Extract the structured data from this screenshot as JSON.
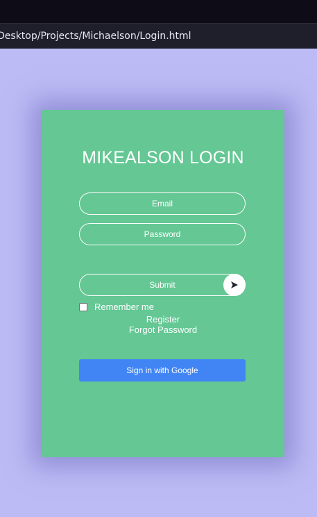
{
  "browser": {
    "address_text": "Desktop/Projects/Michaelson/Login.html"
  },
  "login": {
    "title": "MIKEALSON LOGIN",
    "email_placeholder": "Email",
    "password_placeholder": "Password",
    "submit_label": "Submit",
    "submit_icon": "send-arrow-icon",
    "remember_label": "Remember me",
    "register_link": "Register",
    "forgot_password_link": "Forgot Password",
    "google_button_label": "Sign in with Google"
  },
  "colors": {
    "page_background": "#bdbbf5",
    "card_background": "#64c794",
    "google_button": "#4185f4",
    "text": "#ffffff"
  }
}
